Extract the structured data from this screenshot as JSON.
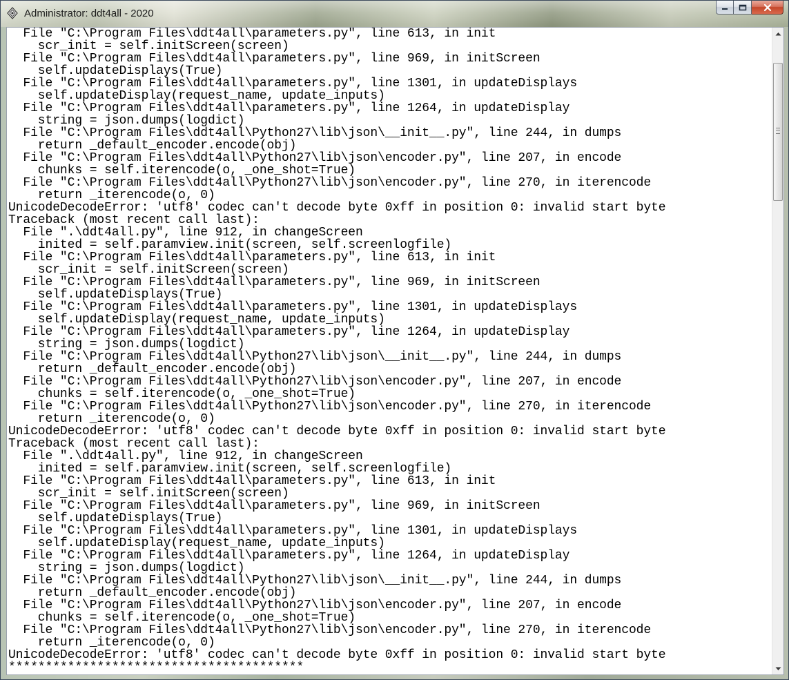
{
  "window": {
    "title": "Administrator: ddt4all - 2020",
    "icon": "ddt4all-app-icon",
    "buttons": {
      "minimize": "minimize-icon",
      "maximize": "maximize-icon",
      "close": "close-icon"
    }
  },
  "console": {
    "lines": [
      "  File \"C:\\Program Files\\ddt4all\\parameters.py\", line 613, in init",
      "    scr_init = self.initScreen(screen)",
      "  File \"C:\\Program Files\\ddt4all\\parameters.py\", line 969, in initScreen",
      "    self.updateDisplays(True)",
      "  File \"C:\\Program Files\\ddt4all\\parameters.py\", line 1301, in updateDisplays",
      "    self.updateDisplay(request_name, update_inputs)",
      "  File \"C:\\Program Files\\ddt4all\\parameters.py\", line 1264, in updateDisplay",
      "    string = json.dumps(logdict)",
      "  File \"C:\\Program Files\\ddt4all\\Python27\\lib\\json\\__init__.py\", line 244, in dumps",
      "    return _default_encoder.encode(obj)",
      "  File \"C:\\Program Files\\ddt4all\\Python27\\lib\\json\\encoder.py\", line 207, in encode",
      "    chunks = self.iterencode(o, _one_shot=True)",
      "  File \"C:\\Program Files\\ddt4all\\Python27\\lib\\json\\encoder.py\", line 270, in iterencode",
      "    return _iterencode(o, 0)",
      "UnicodeDecodeError: 'utf8' codec can't decode byte 0xff in position 0: invalid start byte",
      "Traceback (most recent call last):",
      "  File \".\\ddt4all.py\", line 912, in changeScreen",
      "    inited = self.paramview.init(screen, self.screenlogfile)",
      "  File \"C:\\Program Files\\ddt4all\\parameters.py\", line 613, in init",
      "    scr_init = self.initScreen(screen)",
      "  File \"C:\\Program Files\\ddt4all\\parameters.py\", line 969, in initScreen",
      "    self.updateDisplays(True)",
      "  File \"C:\\Program Files\\ddt4all\\parameters.py\", line 1301, in updateDisplays",
      "    self.updateDisplay(request_name, update_inputs)",
      "  File \"C:\\Program Files\\ddt4all\\parameters.py\", line 1264, in updateDisplay",
      "    string = json.dumps(logdict)",
      "  File \"C:\\Program Files\\ddt4all\\Python27\\lib\\json\\__init__.py\", line 244, in dumps",
      "    return _default_encoder.encode(obj)",
      "  File \"C:\\Program Files\\ddt4all\\Python27\\lib\\json\\encoder.py\", line 207, in encode",
      "    chunks = self.iterencode(o, _one_shot=True)",
      "  File \"C:\\Program Files\\ddt4all\\Python27\\lib\\json\\encoder.py\", line 270, in iterencode",
      "    return _iterencode(o, 0)",
      "UnicodeDecodeError: 'utf8' codec can't decode byte 0xff in position 0: invalid start byte",
      "Traceback (most recent call last):",
      "  File \".\\ddt4all.py\", line 912, in changeScreen",
      "    inited = self.paramview.init(screen, self.screenlogfile)",
      "  File \"C:\\Program Files\\ddt4all\\parameters.py\", line 613, in init",
      "    scr_init = self.initScreen(screen)",
      "  File \"C:\\Program Files\\ddt4all\\parameters.py\", line 969, in initScreen",
      "    self.updateDisplays(True)",
      "  File \"C:\\Program Files\\ddt4all\\parameters.py\", line 1301, in updateDisplays",
      "    self.updateDisplay(request_name, update_inputs)",
      "  File \"C:\\Program Files\\ddt4all\\parameters.py\", line 1264, in updateDisplay",
      "    string = json.dumps(logdict)",
      "  File \"C:\\Program Files\\ddt4all\\Python27\\lib\\json\\__init__.py\", line 244, in dumps",
      "    return _default_encoder.encode(obj)",
      "  File \"C:\\Program Files\\ddt4all\\Python27\\lib\\json\\encoder.py\", line 207, in encode",
      "    chunks = self.iterencode(o, _one_shot=True)",
      "  File \"C:\\Program Files\\ddt4all\\Python27\\lib\\json\\encoder.py\", line 270, in iterencode",
      "    return _iterencode(o, 0)",
      "UnicodeDecodeError: 'utf8' codec can't decode byte 0xff in position 0: invalid start byte",
      "****************************************"
    ]
  },
  "scrollbar": {
    "up_icon": "scroll-up-arrow-icon",
    "down_icon": "scroll-down-arrow-icon"
  }
}
